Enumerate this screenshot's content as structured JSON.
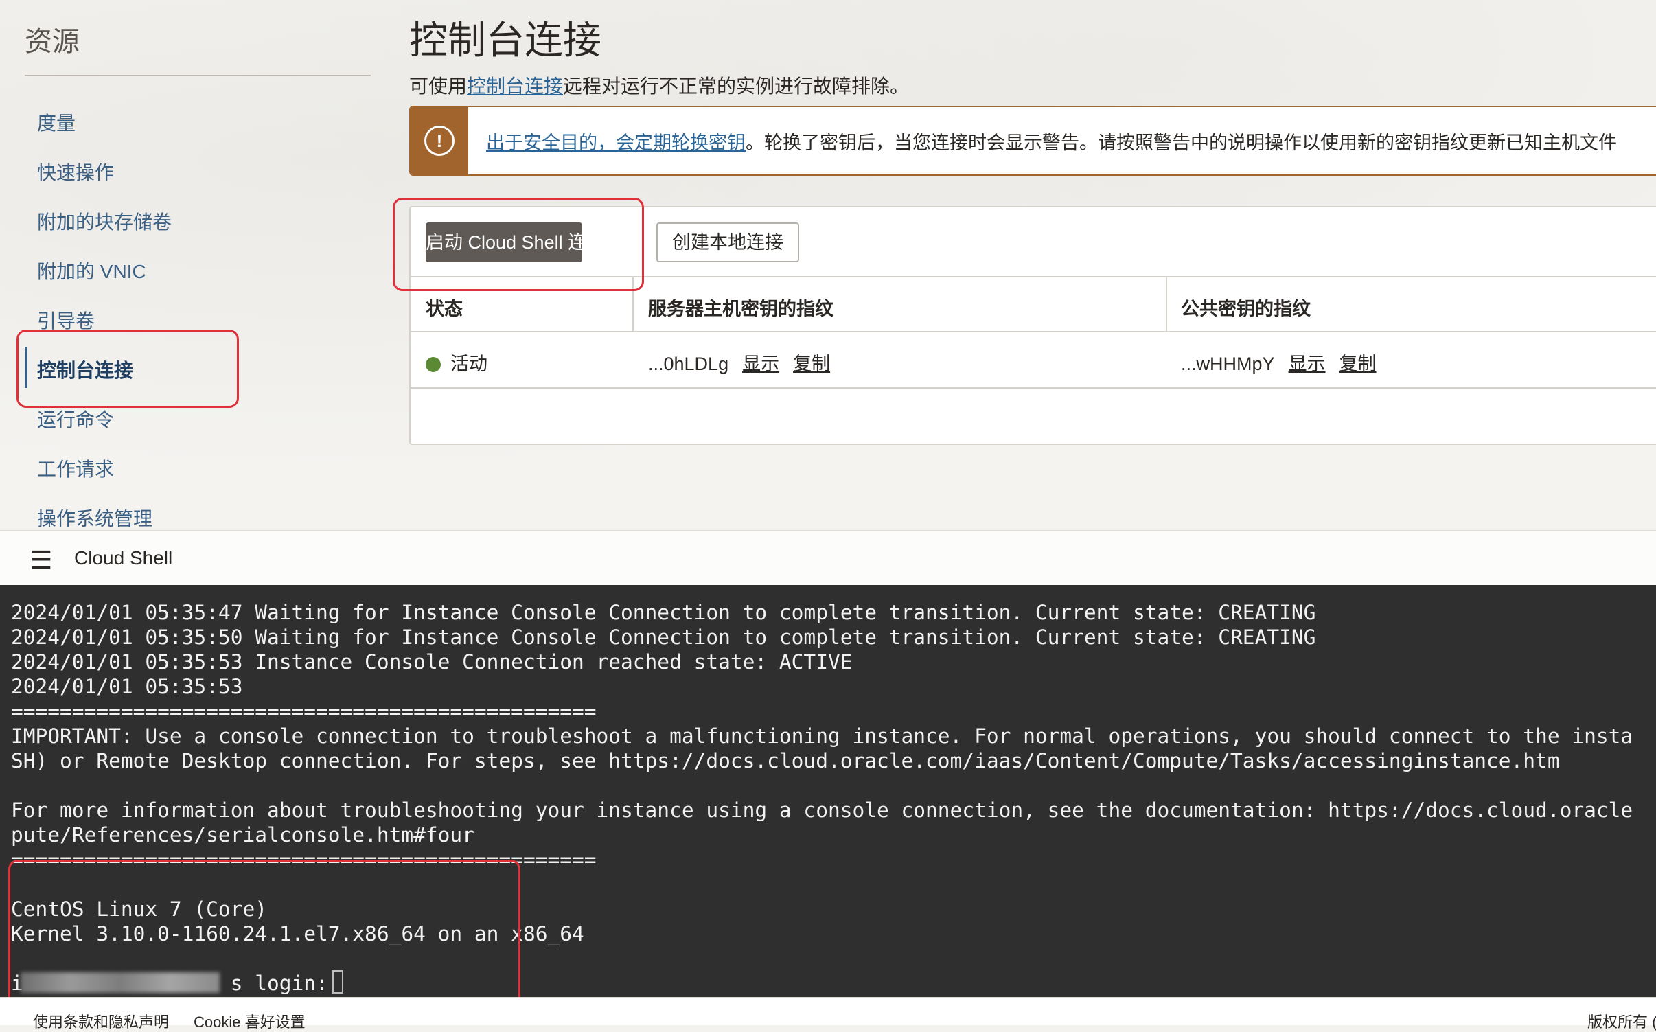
{
  "sidebar": {
    "title": "资源",
    "items": [
      {
        "label": "度量",
        "active": false
      },
      {
        "label": "快速操作",
        "active": false
      },
      {
        "label": "附加的块存储卷",
        "active": false
      },
      {
        "label": "附加的 VNIC",
        "active": false
      },
      {
        "label": "引导卷",
        "active": false
      },
      {
        "label": "控制台连接",
        "active": true
      },
      {
        "label": "运行命令",
        "active": false
      },
      {
        "label": "工作请求",
        "active": false
      },
      {
        "label": "操作系统管理",
        "active": false
      }
    ]
  },
  "main": {
    "title": "控制台连接",
    "subtitle_prefix": "可使用",
    "subtitle_link": "控制台连接",
    "subtitle_suffix": "远程对运行不正常的实例进行故障排除。",
    "alert": {
      "icon": "exclamation-icon",
      "link": "出于安全目的，会定期轮换密钥",
      "text": "。轮换了密钥后，当您连接时会显示警告。请按照警告中的说明操作以使用新的密钥指纹更新已知主机文件"
    },
    "buttons": {
      "launch_cloud_shell": "启动 Cloud Shell 连接",
      "create_local": "创建本地连接"
    },
    "table": {
      "headers": [
        "状态",
        "服务器主机密钥的指纹",
        "公共密钥的指纹"
      ],
      "rows": [
        {
          "status": "活动",
          "server_fingerprint": "...0hLDLg",
          "public_fingerprint": "...wHHMpY",
          "show_label": "显示",
          "copy_label": "复制"
        }
      ]
    }
  },
  "cloud_shell": {
    "menu_icon": "hamburger-icon",
    "title": "Cloud Shell",
    "terminal_lines": [
      "2024/01/01 05:35:47 Waiting for Instance Console Connection to complete transition. Current state: CREATING",
      "2024/01/01 05:35:50 Waiting for Instance Console Connection to complete transition. Current state: CREATING",
      "2024/01/01 05:35:53 Instance Console Connection reached state: ACTIVE",
      "2024/01/01 05:35:53",
      "================================================",
      "IMPORTANT: Use a console connection to troubleshoot a malfunctioning instance. For normal operations, you should connect to the insta",
      "SH) or Remote Desktop connection. For steps, see https://docs.cloud.oracle.com/iaas/Content/Compute/Tasks/accessinginstance.htm",
      "",
      "For more information about troubleshooting your instance using a console connection, see the documentation: https://docs.cloud.oracle",
      "pute/References/serialconsole.htm#four",
      "================================================",
      "",
      "CentOS Linux 7 (Core)",
      "Kernel 3.10.0-1160.24.1.el7.x86_64 on an x86_64",
      "",
      "i                 s login: "
    ]
  },
  "footer": {
    "terms": "使用条款和隐私声明",
    "cookie": "Cookie 喜好设置",
    "copyright": "版权所有 ("
  },
  "colors": {
    "accent_link": "#2a6496",
    "alert_brown": "#a0642c",
    "primary_button": "#5f5a56",
    "status_active": "#5c8a34",
    "terminal_bg": "#2f2f2f",
    "highlight_red": "#e0313b"
  }
}
